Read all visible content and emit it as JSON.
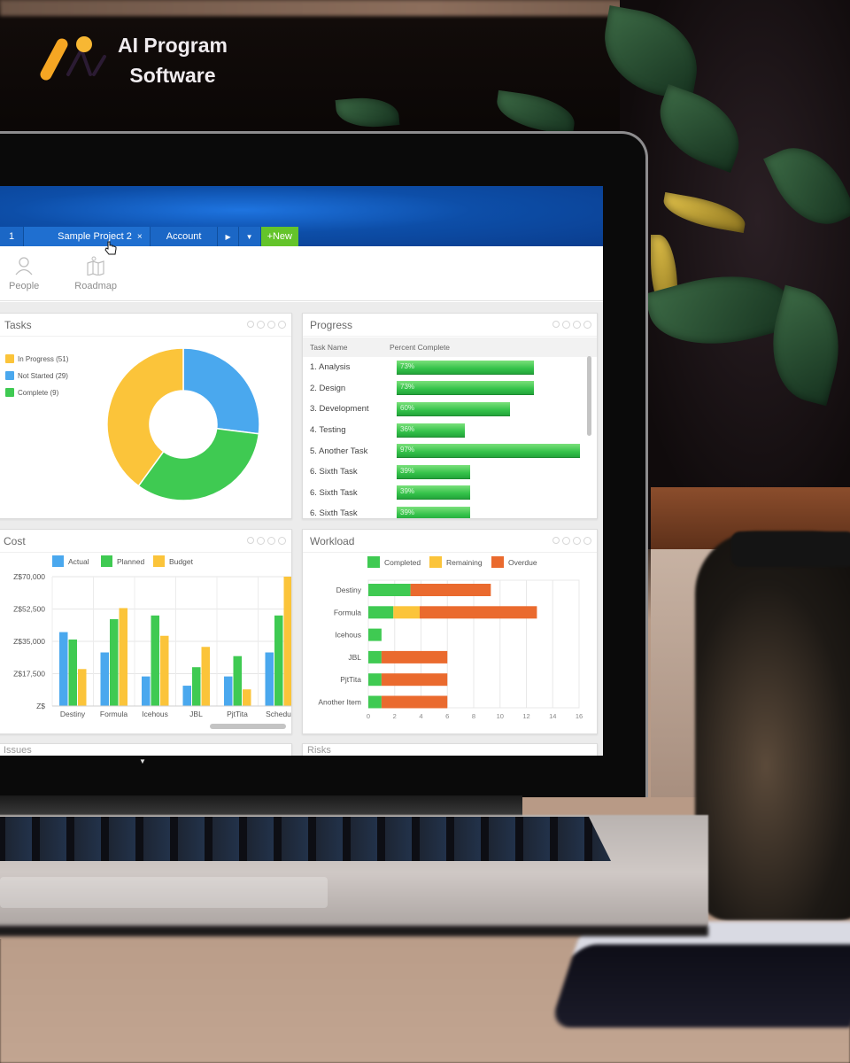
{
  "brand": {
    "line1": "AI Program",
    "line2": "Software",
    "logo_colors": {
      "bar": "#f5a623",
      "dot": "#f7b733"
    }
  },
  "app": {
    "header_color": "#0d4ea8",
    "tabs": [
      {
        "label": "1",
        "closable": false
      },
      {
        "label": "Sample Project 2",
        "closable": true,
        "active": true
      },
      {
        "label": "Account",
        "closable": false
      }
    ],
    "tab_close_glyph": "×",
    "tab_next_glyph": "▶",
    "tab_menu_glyph": "▼",
    "new_button_label": "+New",
    "new_button_color": "#64c42a",
    "toolbar": [
      {
        "label": "People",
        "icon": "person-icon"
      },
      {
        "label": "Roadmap",
        "icon": "roadmap-icon"
      }
    ]
  },
  "panels": {
    "tasks": {
      "title": "Tasks"
    },
    "progress": {
      "title": "Progress",
      "columns": [
        "Task Name",
        "Percent Complete"
      ],
      "rows": [
        {
          "name": "1. Analysis",
          "percent": 73,
          "label": "73%"
        },
        {
          "name": "2. Design",
          "percent": 73,
          "label": "73%"
        },
        {
          "name": "3. Development",
          "percent": 60,
          "label": "60%"
        },
        {
          "name": "4. Testing",
          "percent": 36,
          "label": "36%"
        },
        {
          "name": "5. Another Task",
          "percent": 97,
          "label": "97%"
        },
        {
          "name": "6. Sixth Task",
          "percent": 39,
          "label": "39%"
        },
        {
          "name": "6. Sixth Task",
          "percent": 39,
          "label": "39%"
        },
        {
          "name": "6. Sixth Task",
          "percent": 39,
          "label": "39%"
        }
      ]
    },
    "cost": {
      "title": "Cost"
    },
    "workload": {
      "title": "Workload"
    },
    "bottom_left": {
      "title": "Issues"
    },
    "bottom_right": {
      "title": "Risks"
    }
  },
  "chart_data": [
    {
      "id": "tasks",
      "type": "pie",
      "title": "Tasks",
      "donut": true,
      "labels": [
        "In Progress (51)",
        "Not Started (29)",
        "Complete (9)"
      ],
      "categories": [
        "In Progress",
        "Not Started",
        "Complete"
      ],
      "values": [
        51,
        29,
        9
      ],
      "displayed_share": [
        0.4,
        0.27,
        0.33
      ],
      "colors": [
        "#fbc43a",
        "#4aa8ee",
        "#3fca52"
      ],
      "legend": "left"
    },
    {
      "id": "cost",
      "type": "bar",
      "title": "Cost",
      "categories": [
        "Destiny",
        "Formula",
        "Icehous",
        "JBL",
        "PjtTita",
        "Schedu"
      ],
      "series": [
        {
          "name": "Actual",
          "color": "#4aa8ee",
          "values": [
            40000,
            29000,
            16000,
            11000,
            16000,
            29000
          ]
        },
        {
          "name": "Planned",
          "color": "#3fca52",
          "values": [
            36000,
            47000,
            49000,
            21000,
            27000,
            49000
          ]
        },
        {
          "name": "Budget",
          "color": "#fbc43a",
          "values": [
            20000,
            53000,
            38000,
            32000,
            9000,
            70000
          ]
        }
      ],
      "yticks": [
        "Z$",
        "Z$17,500",
        "Z$35,000",
        "Z$52,500",
        "Z$70,000"
      ],
      "ytick_values": [
        0,
        17500,
        35000,
        52500,
        70000
      ],
      "ylim": [
        0,
        70000
      ],
      "grid": true,
      "legend": "top"
    },
    {
      "id": "workload",
      "type": "bar",
      "orientation": "horizontal",
      "stacked": true,
      "title": "Workload",
      "categories": [
        "Destiny",
        "Formula",
        "Icehous",
        "JBL",
        "PjtTita",
        "Another Item"
      ],
      "series": [
        {
          "name": "Completed",
          "color": "#3fca52",
          "values": [
            3.2,
            1.9,
            1,
            1,
            1,
            1
          ]
        },
        {
          "name": "Remaining",
          "color": "#fbc43a",
          "values": [
            0,
            2.0,
            0,
            0,
            0,
            0
          ]
        },
        {
          "name": "Overdue",
          "color": "#ea6a2e",
          "values": [
            6.1,
            8.9,
            0,
            5,
            5,
            5
          ]
        }
      ],
      "xticks": [
        "0",
        "2",
        "4",
        "6",
        "8",
        "10",
        "12",
        "14",
        "16"
      ],
      "xlim": [
        0,
        16
      ],
      "grid": true,
      "legend": "top"
    }
  ]
}
